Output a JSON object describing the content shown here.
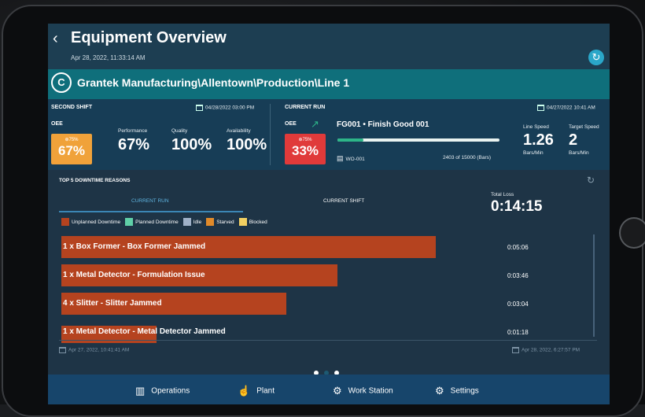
{
  "header": {
    "back_icon": "chevron-left-icon",
    "title": "Equipment Overview",
    "timestamp": "Apr 28, 2022, 11:33:14 AM",
    "refresh_icon": "refresh-icon"
  },
  "breadcrumb": {
    "logo_letter": "C",
    "path": "Grantek Manufacturing\\Allentown\\Production\\Line 1"
  },
  "shift": {
    "label": "SECOND SHIFT",
    "date": "04/28/2022 03:00 PM",
    "oee_label": "OEE",
    "oee_target": "⊕75%",
    "oee_value": "67%",
    "performance_label": "Performance",
    "performance_value": "67%",
    "quality_label": "Quality",
    "quality_value": "100%",
    "availability_label": "Availability",
    "availability_value": "100%",
    "oee_color": "#f0a23a"
  },
  "run": {
    "label": "CURRENT RUN",
    "date": "04/27/2022 10:41 AM",
    "oee_label": "OEE",
    "oee_target": "⊕75%",
    "oee_value": "33%",
    "product": "FG001 • Finish Good 001",
    "work_order": "WO-001",
    "count": "2403 of 15000 (Bars)",
    "progress_fraction": 0.16,
    "line_speed_label": "Line Speed",
    "line_speed_value": "1.26",
    "line_speed_unit": "Bars/Min",
    "target_speed_label": "Target Speed",
    "target_speed_value": "2",
    "target_speed_unit": "Bars/Min",
    "oee_color": "#e03a3a"
  },
  "downtime": {
    "title": "TOP 5 DOWNTIME REASONS",
    "tabs": [
      "CURRENT RUN",
      "CURRENT SHIFT"
    ],
    "total_loss_label": "Total Loss",
    "total_loss_value": "0:14:15",
    "legend": [
      {
        "label": "Unplanned Downtime",
        "color": "#b5431f"
      },
      {
        "label": "Planned Downtime",
        "color": "#5fd0a8"
      },
      {
        "label": "Idle",
        "color": "#9fb1c8"
      },
      {
        "label": "Starved",
        "color": "#e08a2a"
      },
      {
        "label": "Blocked",
        "color": "#f2d062"
      }
    ],
    "rows": [
      {
        "label": "1 x Box Former - Box Former Jammed",
        "time": "0:05:06",
        "fraction": 1.0
      },
      {
        "label": "1 x Metal Detector - Formulation Issue",
        "time": "0:03:46",
        "fraction": 0.737
      },
      {
        "label": "4 x Slitter - Slitter Jammed",
        "time": "0:03:04",
        "fraction": 0.601
      },
      {
        "label": "1 x Metal Detector - Metal Detector Jammed",
        "time": "0:01:18",
        "fraction": 0.255
      }
    ],
    "range_start": "Apr 27, 2022, 10:41:41 AM",
    "range_end": "Apr 28, 2022, 6:27:57 PM"
  },
  "nav": [
    {
      "label": "Operations",
      "icon": "building-icon"
    },
    {
      "label": "Plant",
      "icon": "hand-pointer-icon"
    },
    {
      "label": "Work Station",
      "icon": "user-gear-icon"
    },
    {
      "label": "Settings",
      "icon": "gear-icon"
    }
  ]
}
